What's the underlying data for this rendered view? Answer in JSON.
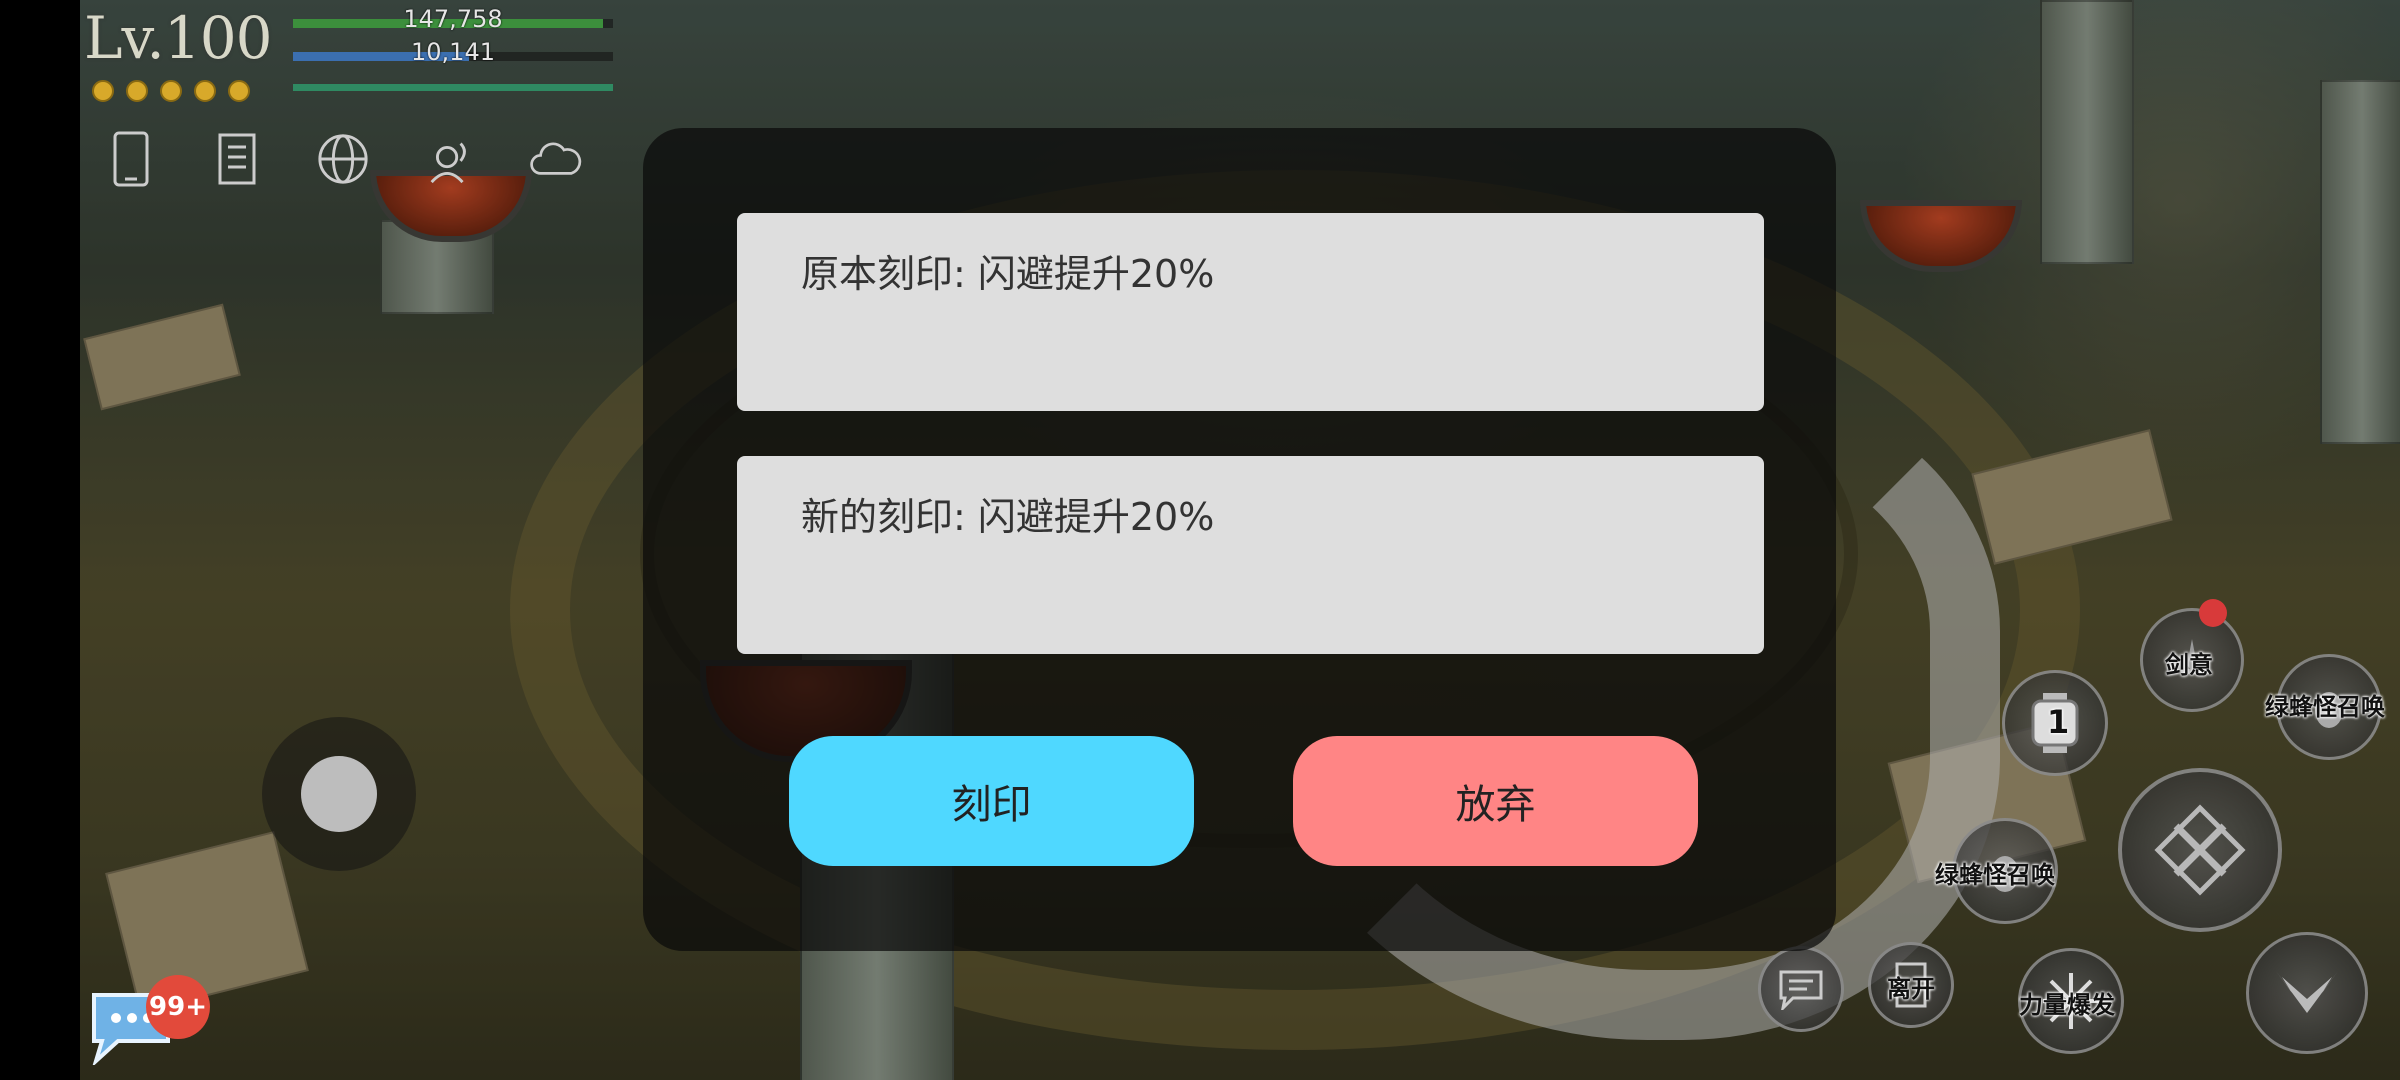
{
  "hud": {
    "level": "Lv.100",
    "hp_value": "147,758",
    "mp_value": "10,141",
    "hp_fraction": 0.97,
    "mp_fraction": 0.55,
    "exp_fraction": 1.0,
    "stars_count": 5,
    "icons": [
      "phone-icon",
      "scroll-icon",
      "globe-icon",
      "voice-icon",
      "cloud-icon"
    ]
  },
  "dialog": {
    "original_label": "原本刻印: 闪避提升20%",
    "new_label": "新的刻印: 闪避提升20%",
    "engrave_button": "刻印",
    "abandon_button": "放弃"
  },
  "chat": {
    "badge": "99+"
  },
  "skills": {
    "sword_intent": "剑意",
    "summon_top": "绿蜂怪召唤",
    "summon_left": "绿蜂怪召唤",
    "slot_number": "1",
    "leave": "离开",
    "power_burst": "力量爆发"
  },
  "colors": {
    "engrave_button": "#4fd8ff",
    "abandon_button": "#ff8585",
    "hp_bar": "#3c8f3c",
    "mp_bar": "#3b6fb0",
    "exp_bar": "#2f8a62"
  }
}
